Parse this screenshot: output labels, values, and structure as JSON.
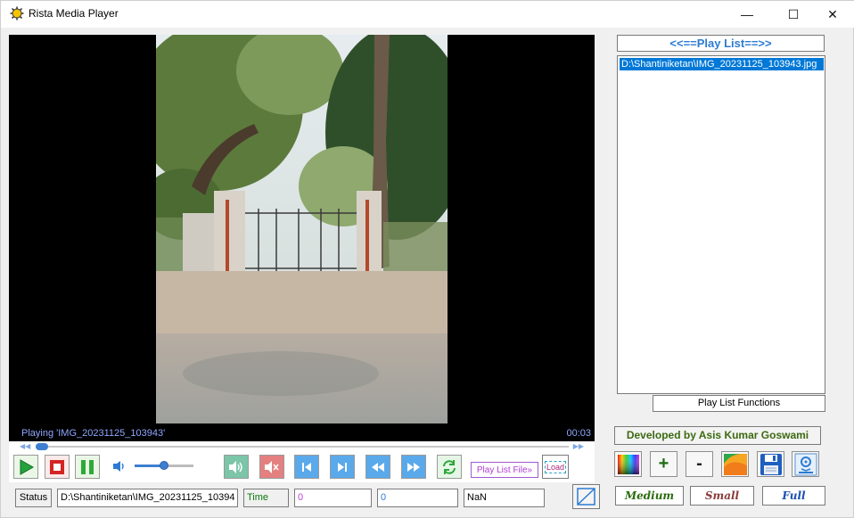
{
  "window": {
    "title": "Rista Media Player",
    "min_glyph": "—",
    "max_glyph": "☐",
    "close_glyph": "✕"
  },
  "player": {
    "now_playing": "Playing 'IMG_20231125_103943'",
    "elapsed": "00:03",
    "volume_fraction": 0.5,
    "seek_fraction": 0.0
  },
  "controls": {
    "playlist_file_label": "Play List File»",
    "load_label": "Load"
  },
  "statusbar": {
    "status_label": "Status",
    "path": "D:\\Shantiniketan\\IMG_20231125_10394",
    "time_label": "Time",
    "value1": "0",
    "value2": "0",
    "value3": "NaN"
  },
  "playlist": {
    "title": "<<==Play List==>>",
    "items": [
      "D:\\Shantiniketan\\IMG_20231125_103943.jpg"
    ],
    "functions_label": "Play List Functions",
    "developer": "Developed by Asis Kumar Goswami"
  },
  "size_buttons": {
    "medium": "Medium",
    "small": "Small",
    "full": "Full"
  },
  "tools": {
    "plus": "+",
    "minus": "-"
  },
  "colors": {
    "accent_blue": "#3d7fd1",
    "selection": "#0078d7",
    "playlist_title": "#2c7bd3"
  }
}
